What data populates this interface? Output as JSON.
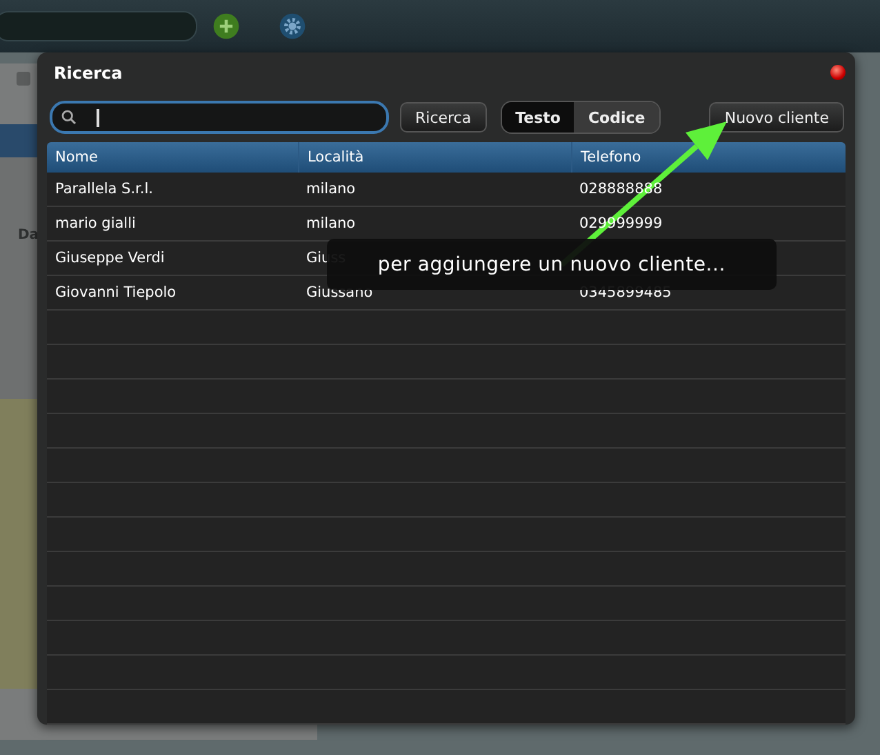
{
  "background": {
    "column_label": "Da"
  },
  "dialog": {
    "title": "Ricerca",
    "search_button": "Ricerca",
    "modes": [
      {
        "label": "Testo",
        "selected": true
      },
      {
        "label": "Codice",
        "selected": false
      }
    ],
    "new_button": "Nuovo cliente",
    "table": {
      "columns": [
        "Nome",
        "Località",
        "Telefono"
      ],
      "rows": [
        {
          "nome": "Parallela S.r.l.",
          "localita": "milano",
          "telefono": "028888888"
        },
        {
          "nome": "mario gialli",
          "localita": "milano",
          "telefono": "029999999"
        },
        {
          "nome": "Giuseppe Verdi",
          "localita": "Giuss"
        },
        {
          "nome": "Giovanni Tiepolo",
          "localita": "Giussano",
          "telefono": "0345899485"
        }
      ]
    }
  },
  "callout": {
    "text": "per aggiungere un nuovo cliente..."
  }
}
